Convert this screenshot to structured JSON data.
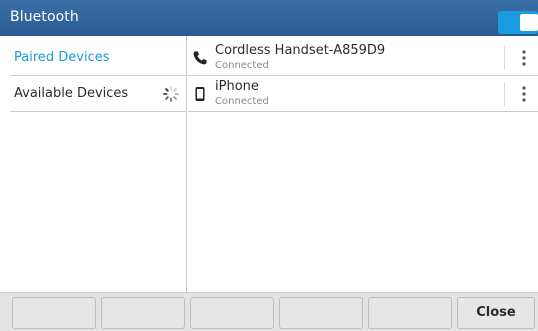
{
  "header": {
    "title": "Bluetooth",
    "toggle_on": true,
    "toggle_color": "#1a9be0"
  },
  "nav": {
    "items": [
      {
        "label": "Paired Devices",
        "active": true
      },
      {
        "label": "Available Devices",
        "active": false,
        "loading": true
      }
    ]
  },
  "devices": [
    {
      "name": "Cordless Handset-A859D9",
      "status": "Connected",
      "icon": "phone-handset-icon"
    },
    {
      "name": "iPhone",
      "status": "Connected",
      "icon": "mobile-phone-icon"
    }
  ],
  "softkeys": [
    {
      "label": ""
    },
    {
      "label": ""
    },
    {
      "label": ""
    },
    {
      "label": ""
    },
    {
      "label": ""
    },
    {
      "label": "Close"
    }
  ],
  "colors": {
    "accent": "#1e9ad6",
    "title_bar": "#2f639a"
  }
}
